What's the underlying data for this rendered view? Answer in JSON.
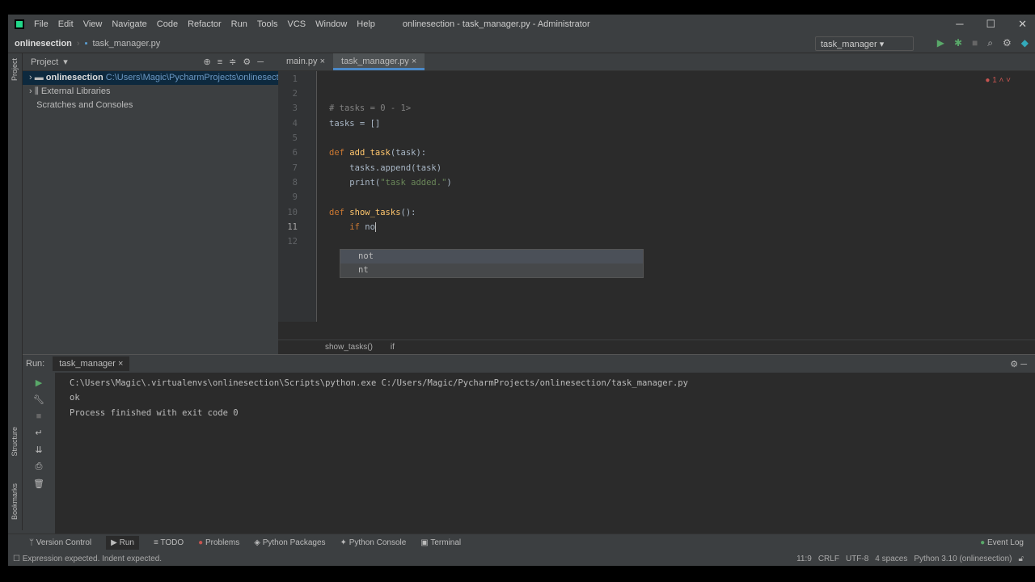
{
  "window": {
    "title": "onlinesection - task_manager.py - Administrator"
  },
  "menu": [
    "File",
    "Edit",
    "View",
    "Navigate",
    "Code",
    "Refactor",
    "Run",
    "Tools",
    "VCS",
    "Window",
    "Help"
  ],
  "nav": {
    "project": "onlinesection",
    "file": "task_manager.py",
    "run_config": "task_manager"
  },
  "project_panel": {
    "title": "Project",
    "items": [
      {
        "name": "onlinesection",
        "path": "C:\\Users\\Magic\\PycharmProjects\\onlinesection"
      },
      {
        "name": "External Libraries"
      },
      {
        "name": "Scratches and Consoles"
      }
    ]
  },
  "left_strip": {
    "project": "Project",
    "structure": "Structure",
    "bookmarks": "Bookmarks"
  },
  "editor": {
    "tabs": [
      "main.py",
      "task_manager.py"
    ],
    "active_tab": 1,
    "error_count": "1",
    "lines": [
      "1",
      "2",
      "3",
      "4",
      "5",
      "6",
      "7",
      "8",
      "9",
      "10",
      "11",
      "12"
    ],
    "code": {
      "l3": "# tasks = 0 - 1>",
      "l4": "tasks = []",
      "l6_kw": "def ",
      "l6_fn": "add_task",
      "l6_rest": "(task):",
      "l7": "    tasks.append(task)",
      "l8_a": "    print(",
      "l8_s": "\"task added.\"",
      "l8_b": ")",
      "l10_kw": "def ",
      "l10_fn": "show_tasks",
      "l10_rest": "():",
      "l11_kw": "    if ",
      "l11_rest": "no"
    },
    "completion": [
      "not",
      "nt"
    ],
    "breadcrumb": [
      "show_tasks()",
      "if"
    ]
  },
  "run": {
    "label": "Run:",
    "tab": "task_manager",
    "output": [
      "C:\\Users\\Magic\\.virtualenvs\\onlinesection\\Scripts\\python.exe C:/Users/Magic/PycharmProjects/onlinesection/task_manager.py",
      "ok",
      "",
      "Process finished with exit code 0"
    ]
  },
  "bottom_tabs": [
    "Version Control",
    "Run",
    "TODO",
    "Problems",
    "Python Packages",
    "Python Console",
    "Terminal"
  ],
  "event_log": "Event Log",
  "status": {
    "message": "Expression expected. Indent expected.",
    "position": "11:9",
    "line_sep": "CRLF",
    "encoding": "UTF-8",
    "indent": "4 spaces",
    "interpreter": "Python 3.10 (onlinesection)"
  }
}
